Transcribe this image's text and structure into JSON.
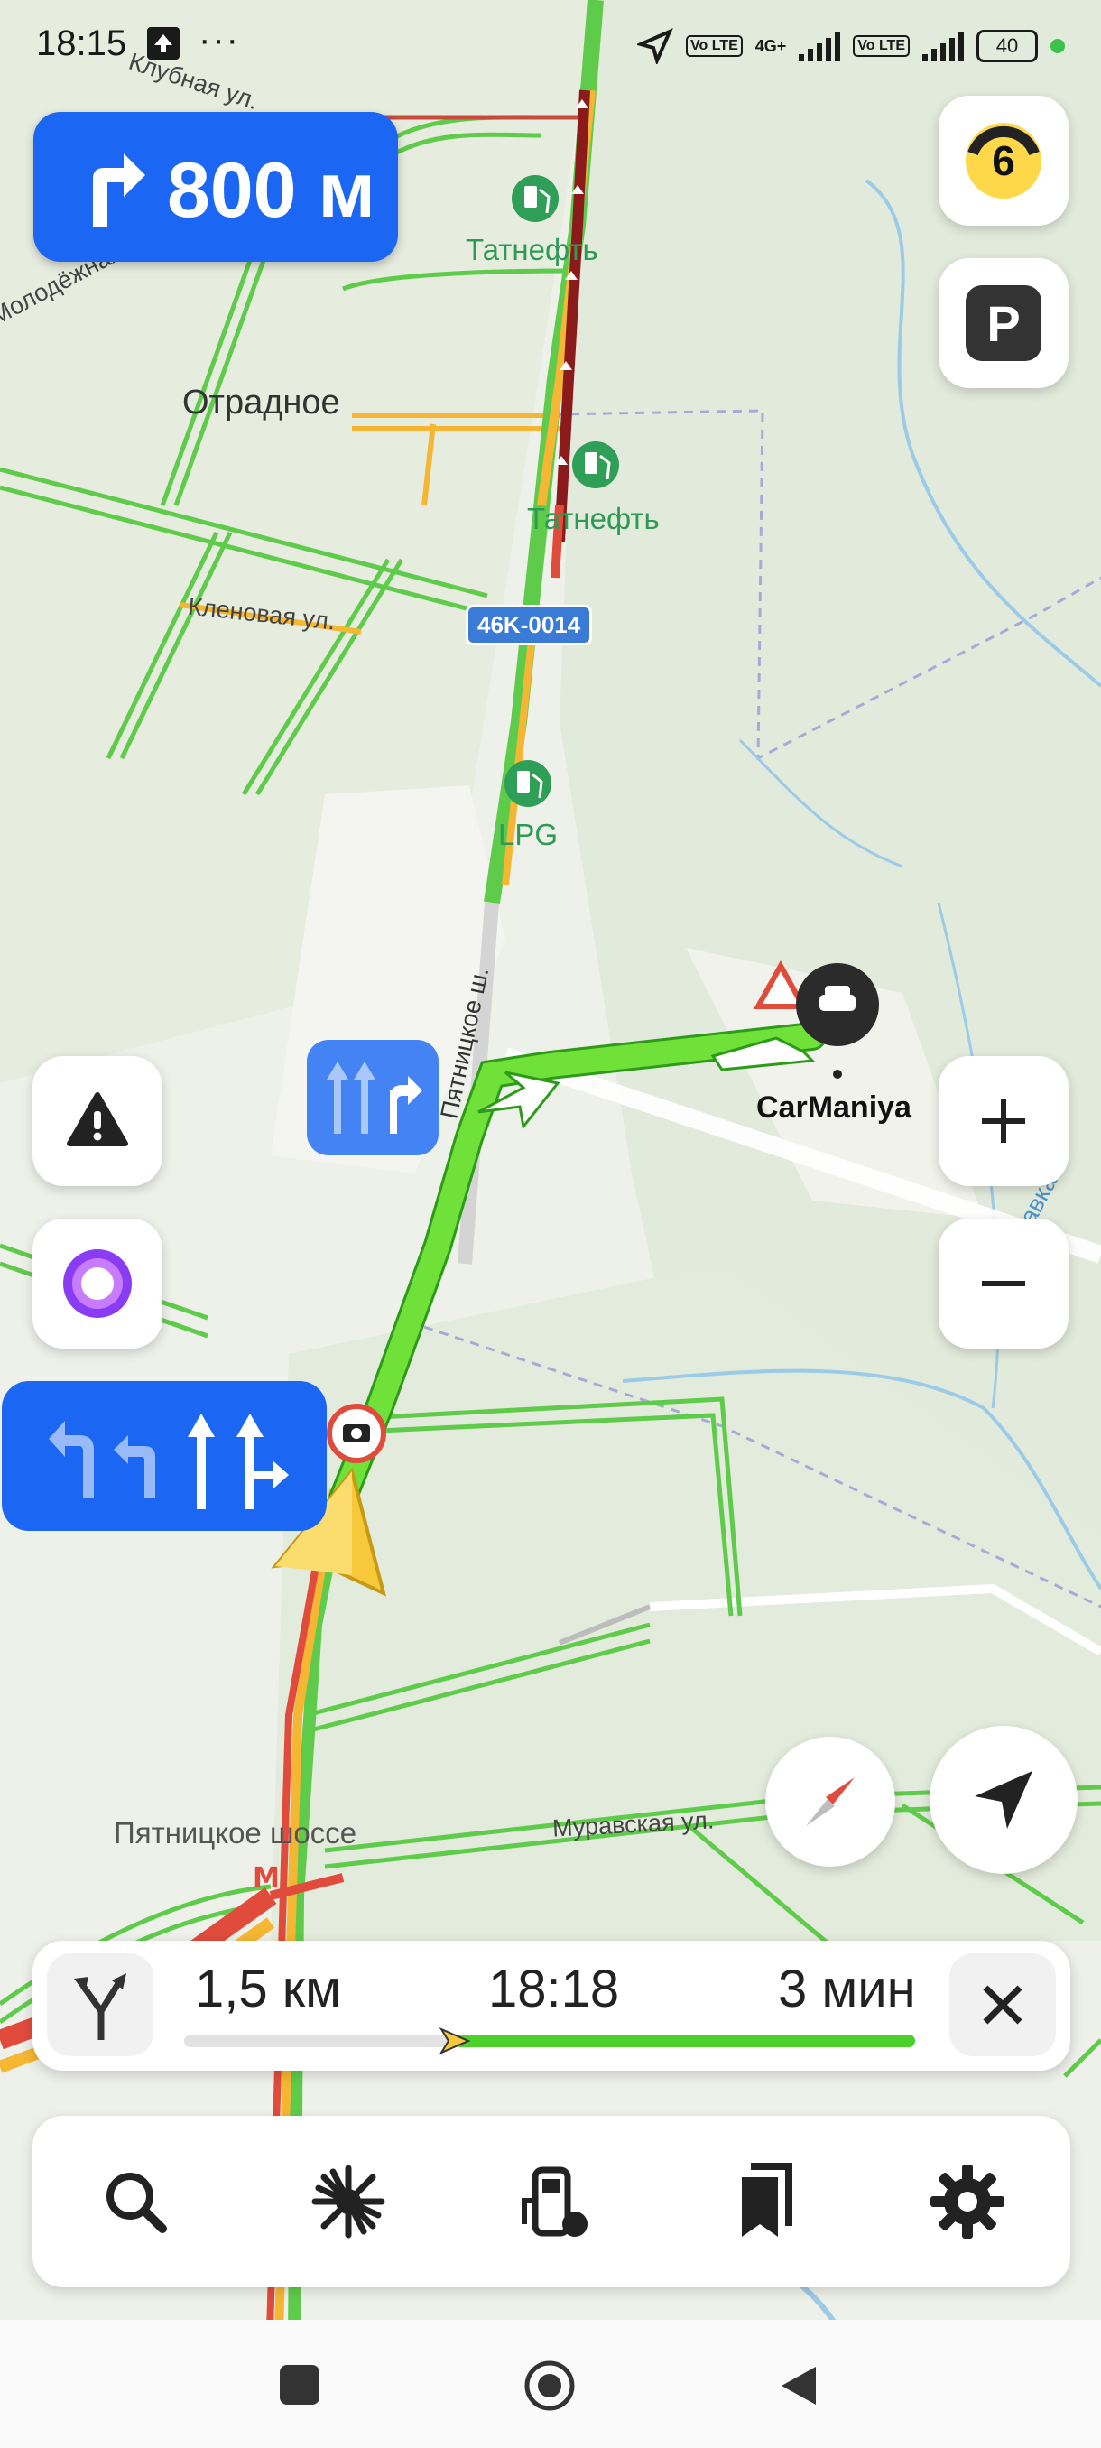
{
  "status_bar": {
    "time": "18:15",
    "lte1": "Vo LTE",
    "net": "4G+",
    "lte2": "Vo LTE",
    "battery": "40"
  },
  "maneuver": {
    "distance": "800 м"
  },
  "traffic": {
    "level": "6"
  },
  "map_labels": {
    "otradnoe": "Отрадное",
    "tatneft1": "Татнефть",
    "tatneft2": "Татнефть",
    "lpg": "LPG",
    "road_badge": "46K-0014",
    "klenovaya": "Кленовая ул.",
    "klubnaya": "Клубная ул.",
    "molodezhnaya": "Молодёжная",
    "pyatnitskoe_sh": "Пятницкое ш.",
    "pyatnitskoe_shosse": "Пятницкое шоссе",
    "muravskaya": "Муравская ул.",
    "river": "р. Журавка",
    "carmaniya": "CarManiya"
  },
  "route": {
    "distance": "1,5 км",
    "arrival": "18:18",
    "duration": "3 мин",
    "progress": 0.37
  },
  "toolbar": {
    "items": [
      "search-icon",
      "discovery-icon",
      "gas-station-icon",
      "bookmarks-icon",
      "settings-icon"
    ]
  },
  "colors": {
    "accent": "#1b66f2",
    "route": "#4bd12a",
    "traffic_heavy": "#8b1a1a",
    "traffic_mid": "#f5b634",
    "road_green": "#5fcb4a"
  }
}
